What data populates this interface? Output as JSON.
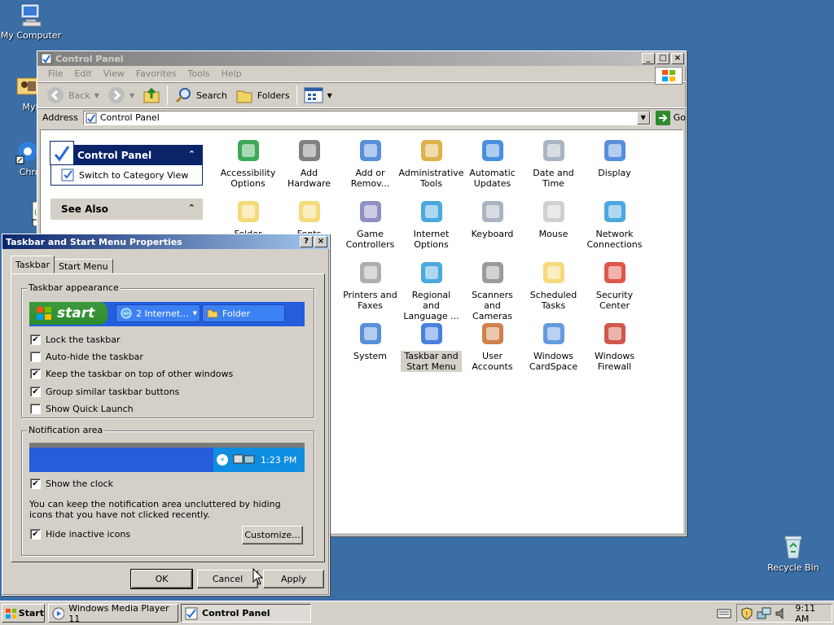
{
  "desktop": {
    "icons": [
      {
        "label": "My Computer",
        "icon": "my-computer-icon"
      },
      {
        "label": "MyPa",
        "icon": "my-pictures-icon"
      },
      {
        "label": "Chrom",
        "icon": "chrome-icon"
      },
      {
        "label": "",
        "icon": "shortcut-icon"
      },
      {
        "label": "Recycle Bin",
        "icon": "recycle-bin-icon"
      }
    ]
  },
  "control_panel": {
    "title": "Control Panel",
    "menu": [
      "File",
      "Edit",
      "View",
      "Favorites",
      "Tools",
      "Help"
    ],
    "toolbar": {
      "back": "Back",
      "search": "Search",
      "folders": "Folders"
    },
    "address": {
      "label": "Address",
      "value": "Control Panel",
      "go": "Go"
    },
    "tasks": {
      "title": "Control Panel",
      "switch_link": "Switch to Category View",
      "see_also": "See Also"
    },
    "items": [
      {
        "label": "Accessibility Options",
        "icon": "accessibility-icon"
      },
      {
        "label": "Add Hardware",
        "icon": "add-hardware-icon"
      },
      {
        "label": "Add or Remov...",
        "icon": "add-remove-programs-icon"
      },
      {
        "label": "Administrative Tools",
        "icon": "administrative-tools-icon"
      },
      {
        "label": "Automatic Updates",
        "icon": "automatic-updates-icon"
      },
      {
        "label": "Date and Time",
        "icon": "date-time-icon"
      },
      {
        "label": "Display",
        "icon": "display-icon"
      },
      {
        "label": "Folder Options",
        "icon": "folder-options-icon"
      },
      {
        "label": "Fonts",
        "icon": "fonts-icon"
      },
      {
        "label": "Game Controllers",
        "icon": "game-controllers-icon"
      },
      {
        "label": "Internet Options",
        "icon": "internet-options-icon"
      },
      {
        "label": "Keyboard",
        "icon": "keyboard-icon"
      },
      {
        "label": "Mouse",
        "icon": "mouse-icon"
      },
      {
        "label": "Network Connections",
        "icon": "network-connections-icon"
      },
      {
        "label": "",
        "icon": ""
      },
      {
        "label": "",
        "icon": ""
      },
      {
        "label": "Printers and Faxes",
        "icon": "printers-faxes-icon"
      },
      {
        "label": "Regional and Language ...",
        "icon": "regional-language-icon"
      },
      {
        "label": "Scanners and Cameras",
        "icon": "scanners-cameras-icon"
      },
      {
        "label": "Scheduled Tasks",
        "icon": "scheduled-tasks-icon"
      },
      {
        "label": "Security Center",
        "icon": "security-center-icon"
      },
      {
        "label": "",
        "icon": ""
      },
      {
        "label": "",
        "icon": ""
      },
      {
        "label": "System",
        "icon": "system-icon"
      },
      {
        "label": "Taskbar and Start Menu",
        "icon": "taskbar-start-menu-icon"
      },
      {
        "label": "User Accounts",
        "icon": "user-accounts-icon"
      },
      {
        "label": "Windows CardSpace",
        "icon": "windows-cardspace-icon"
      },
      {
        "label": "Windows Firewall",
        "icon": "windows-firewall-icon"
      }
    ]
  },
  "dialog": {
    "title": "Taskbar and Start Menu Properties",
    "tabs": [
      "Taskbar",
      "Start Menu"
    ],
    "appearance": {
      "title": "Taskbar appearance",
      "preview": {
        "start": "start",
        "task1": "2 Internet...",
        "task2": "Folder"
      },
      "options": [
        {
          "label": "Lock the taskbar",
          "checked": true
        },
        {
          "label": "Auto-hide the taskbar",
          "checked": false
        },
        {
          "label": "Keep the taskbar on top of other windows",
          "checked": true
        },
        {
          "label": "Group similar taskbar buttons",
          "checked": true
        },
        {
          "label": "Show Quick Launch",
          "checked": false
        }
      ]
    },
    "notification": {
      "title": "Notification area",
      "preview_time": "1:23 PM",
      "show_clock": {
        "label": "Show the clock",
        "checked": true
      },
      "description": "You can keep the notification area uncluttered by hiding icons that you have not clicked recently.",
      "hide_inactive": {
        "label": "Hide inactive icons",
        "checked": true
      },
      "customize": "Customize..."
    },
    "buttons": {
      "ok": "OK",
      "cancel": "Cancel",
      "apply": "Apply"
    }
  },
  "taskbar": {
    "start": "Start",
    "tasks": [
      {
        "label": "Windows Media Player 11",
        "icon": "media-player-icon",
        "active": false
      },
      {
        "label": "Control Panel",
        "icon": "control-panel-icon",
        "active": true
      }
    ],
    "clock": "9:11 AM"
  }
}
